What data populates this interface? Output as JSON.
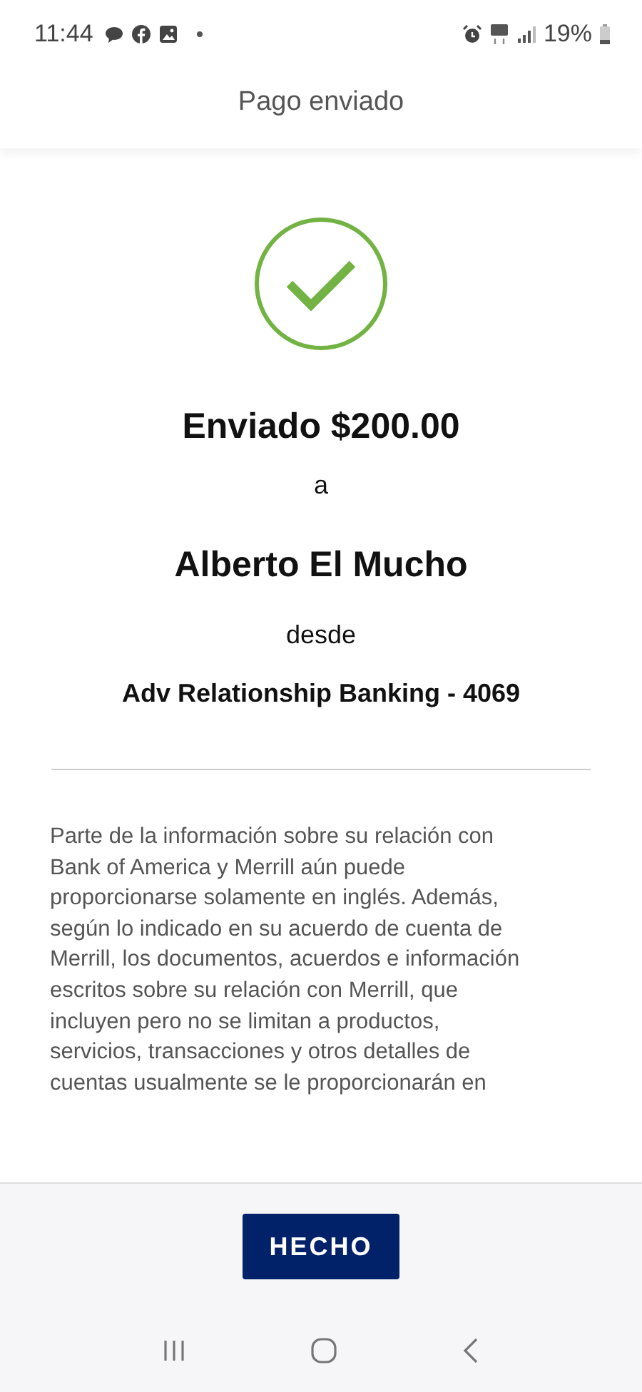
{
  "status_bar": {
    "time": "11:44",
    "battery": "19%"
  },
  "header": {
    "title": "Pago enviado"
  },
  "confirmation": {
    "amount_line": "Enviado $200.00",
    "to_label": "a",
    "recipient": "Alberto El Mucho",
    "from_label": "desde",
    "account": "Adv Relationship Banking - 4069"
  },
  "disclaimer": [
    "Parte de la información sobre su relación con",
    "Bank of America y Merrill aún puede",
    "proporcionarse solamente en inglés. Además,",
    "según lo indicado en su acuerdo de cuenta de",
    "Merrill, los documentos, acuerdos e información",
    "escritos sobre su relación con Merrill, que",
    "incluyen pero no se limitan a productos,",
    "servicios, transacciones y otros detalles de",
    "cuentas usualmente se le proporcionarán en"
  ],
  "footer": {
    "button": "HECHO"
  }
}
